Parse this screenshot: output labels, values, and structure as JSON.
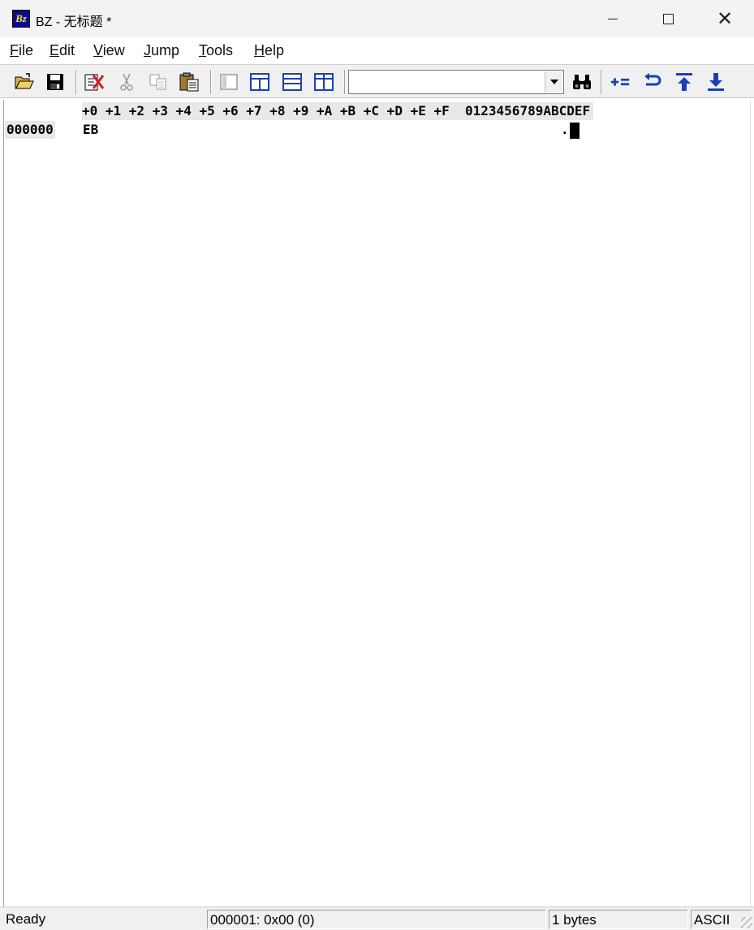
{
  "window": {
    "icon_text": "Bz",
    "title": "BZ - 无标题 *"
  },
  "menu": {
    "items": [
      {
        "label": "File",
        "key": "F",
        "rest": "ile"
      },
      {
        "label": "Edit",
        "key": "E",
        "rest": "dit"
      },
      {
        "label": "View",
        "key": "V",
        "rest": "iew"
      },
      {
        "label": "Jump",
        "key": "J",
        "rest": "ump"
      },
      {
        "label": "Tools",
        "key": "T",
        "rest": "ools"
      },
      {
        "label": "Help",
        "key": "H",
        "rest": "elp"
      }
    ]
  },
  "toolbar": {
    "buttons": [
      "open-icon",
      "save-icon",
      "delete-icon",
      "cut-icon",
      "copy-icon",
      "paste-icon",
      "single-view-icon",
      "split-vertical-icon",
      "split-horizontal-icon",
      "compare-view-icon",
      "find-icon",
      "calculator-icon",
      "undo-icon",
      "jump-top-icon",
      "download-icon"
    ],
    "search_value": ""
  },
  "hex": {
    "header": "+0 +1 +2 +3 +4 +5 +6 +7 +8 +9 +A +B +C +D +E +F  0123456789ABCDEF",
    "rows": [
      {
        "offset": "000000",
        "bytes": "EB",
        "ascii": "."
      }
    ]
  },
  "status": {
    "state": "Ready",
    "position": "000001: 0x00 (0)",
    "size": "1 bytes",
    "encoding": "ASCII"
  },
  "colors": {
    "header_bg": "#e8e8e8",
    "toolbar_blue": "#1a3fb8",
    "icon_bg": "#0a0a8a",
    "icon_fg": "#f7e600"
  }
}
